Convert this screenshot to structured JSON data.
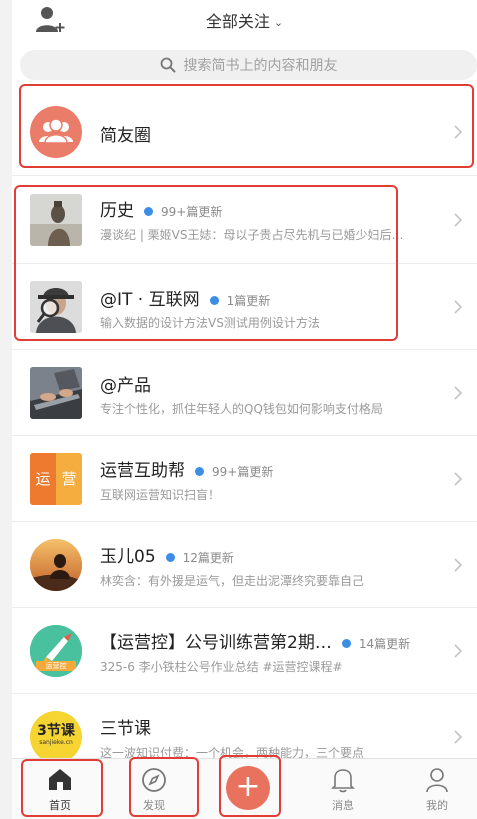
{
  "colors": {
    "accent": "#e9725f",
    "highlight": "#e23d35",
    "update_dot": "#3b8de6"
  },
  "header": {
    "title": "全部关注",
    "title_icon": "chevron-down-icon",
    "left_icon": "add-user-icon"
  },
  "search": {
    "placeholder": "搜索简书上的内容和朋友",
    "icon": "search-icon"
  },
  "circle": {
    "label": "简友圈",
    "icon": "group-icon"
  },
  "list": [
    {
      "name": "历史",
      "badge": "99+篇更新",
      "subtitle": "漫谈纪 | 栗姬VS王娡：母以子贵占尽先机与已婚少妇后…",
      "avatar": "statue"
    },
    {
      "name": "@IT · 互联网",
      "badge": "1篇更新",
      "subtitle": "输入数据的设计方法VS测试用例设计方法",
      "avatar": "magnifier"
    },
    {
      "name": "@产品",
      "badge": "",
      "subtitle": "专注个性化，抓住年轻人的QQ钱包如何影响支付格局",
      "avatar": "laptop"
    },
    {
      "name": "运营互助帮",
      "badge": "99+篇更新",
      "subtitle": "互联网运营知识扫盲！",
      "avatar": "yunying",
      "avatar_text_1": "运",
      "avatar_text_2": "营"
    },
    {
      "name": "玉儿05",
      "badge": "12篇更新",
      "subtitle": "林奕含：有外援是运气，但走出泥潭终究要靠自己",
      "avatar": "sunset"
    },
    {
      "name": "【运营控】公号训练营第2期…",
      "badge": "14篇更新",
      "subtitle": "325-6 李小铁柱公号作业总结 #运营控课程#",
      "avatar": "rocket",
      "avatar_text": "运营控"
    },
    {
      "name": "三节课",
      "badge": "",
      "subtitle": "这一波知识付费：一个机会，两种能力，三个要点",
      "avatar": "sanjieke",
      "avatar_text": "3节课",
      "avatar_text_small": "sanjieke.cn"
    }
  ],
  "tabbar": [
    {
      "label": "首页",
      "icon": "home-icon"
    },
    {
      "label": "发现",
      "icon": "compass-icon"
    },
    {
      "label": "",
      "icon": "plus-icon"
    },
    {
      "label": "消息",
      "icon": "bell-icon"
    },
    {
      "label": "我的",
      "icon": "person-icon"
    }
  ]
}
